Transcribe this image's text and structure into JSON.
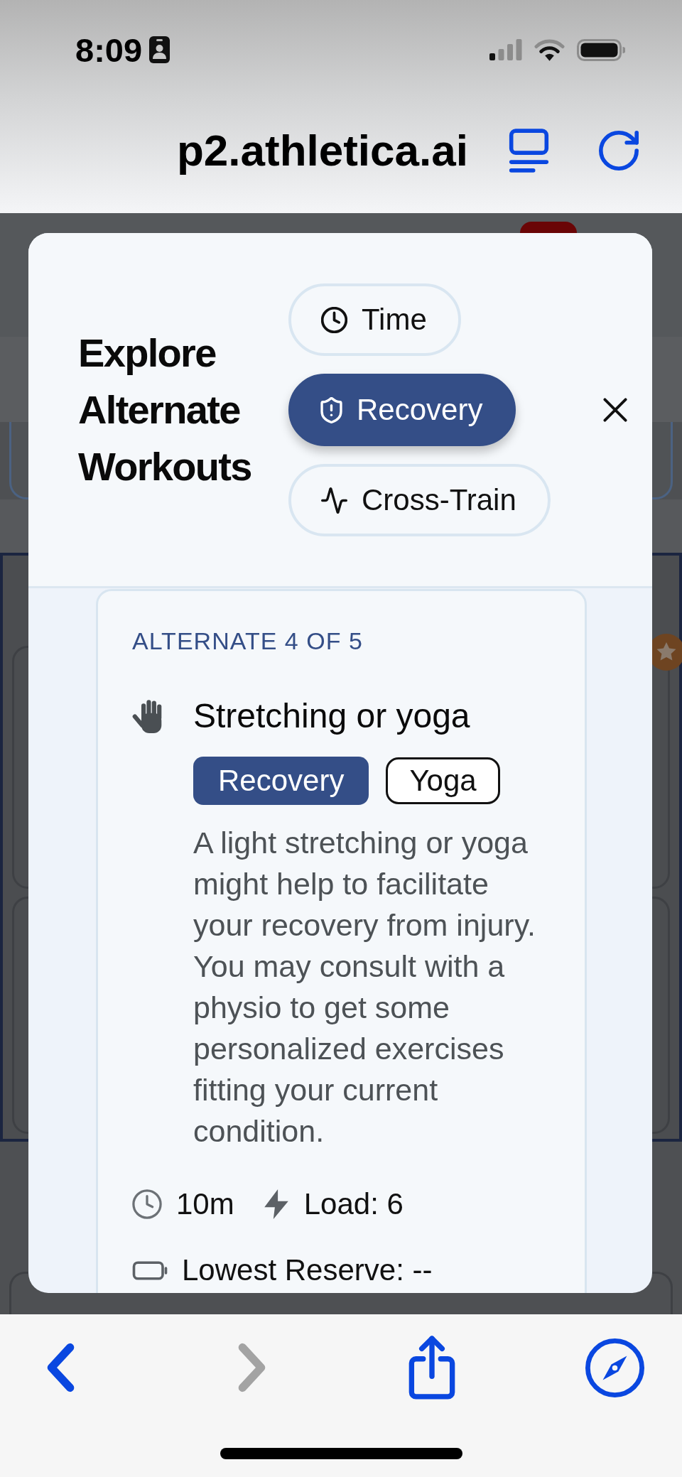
{
  "status_bar": {
    "time": "8:09"
  },
  "address_bar": {
    "url": "p2.athletica.ai"
  },
  "modal": {
    "title": "Explore Alternate Workouts",
    "filters": [
      {
        "kind": "time",
        "label": "Time",
        "selected": false
      },
      {
        "kind": "recovery",
        "label": "Recovery",
        "selected": true
      },
      {
        "kind": "cross_train",
        "label": "Cross-Train",
        "selected": false
      }
    ],
    "card": {
      "counter": "ALTERNATE 4 OF 5",
      "title": "Stretching or yoga",
      "tags": [
        {
          "kind": "filled",
          "label": "Recovery"
        },
        {
          "kind": "outline",
          "label": "Yoga"
        }
      ],
      "description": "A light stretching or yoga might help to facilitate your recovery from injury. You may consult with a physio to get some personalized exercises fitting your current condition.",
      "stats": [
        {
          "kind": "duration",
          "value": "10m"
        },
        {
          "kind": "load",
          "value": "Load: 6"
        },
        {
          "kind": "reserve",
          "value": "Lowest Reserve: --"
        }
      ]
    }
  },
  "toolbar": {
    "buttons": [
      {
        "kind": "back",
        "disabled": false
      },
      {
        "kind": "forward",
        "disabled": true
      },
      {
        "kind": "share",
        "disabled": false
      },
      {
        "kind": "compass",
        "disabled": false
      }
    ]
  }
}
